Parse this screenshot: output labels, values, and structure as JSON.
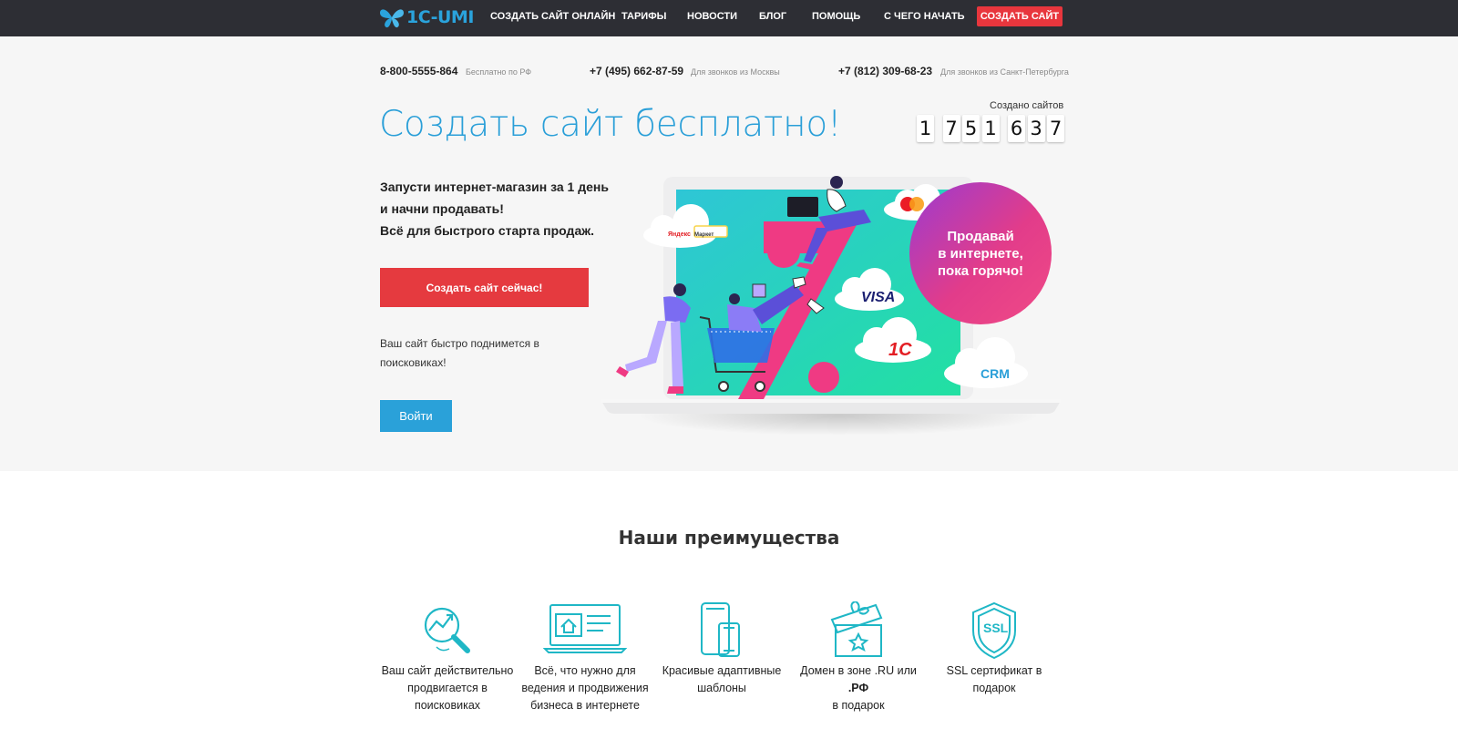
{
  "nav": {
    "logo_text": "1C-UMI",
    "items": [
      "СОЗДАТЬ САЙТ ОНЛАЙН",
      "ТАРИФЫ",
      "НОВОСТИ",
      "БЛОГ",
      "ПОМОЩЬ",
      "С ЧЕГО НАЧАТЬ"
    ],
    "cta_label": "СОЗДАТЬ САЙТ"
  },
  "phones": [
    {
      "number": "8-800-5555-864",
      "note": "Бесплатно по РФ"
    },
    {
      "number": "+7 (495) 662-87-59",
      "note": "Для звонков из Москвы"
    },
    {
      "number": "+7 (812) 309-68-23",
      "note": "Для звонков из Санкт-Петербурга"
    }
  ],
  "counter": {
    "label": "Создано сайтов",
    "digits": [
      "1",
      "7",
      "5",
      "1",
      "6",
      "3",
      "7"
    ]
  },
  "hero": {
    "title": "Создать сайт бесплатно!",
    "lead_lines": [
      "Запусти интернет-магазин за 1 день",
      "и начни продавать!",
      "Всё для быстрого старта продаж."
    ],
    "cta_label": "Создать сайт сейчас!",
    "seo_lines": [
      "Ваш сайт быстро поднимется в",
      "поисковиках!"
    ],
    "login_label": "Войти"
  },
  "illustration": {
    "promo_lines": [
      "Продавай",
      "в интернете,",
      "пока горячо!"
    ],
    "yandex_left": "Яндекс",
    "yandex_right": "Маркет",
    "visa": "VISA",
    "onec": "1С",
    "crm": "CRM"
  },
  "advantages": {
    "title": "Наши преимущества",
    "items": [
      {
        "icon": "seo-magnifier-icon",
        "lines": [
          "Ваш сайт действительно",
          "продвигается в",
          "поисковиках"
        ]
      },
      {
        "icon": "laptop-store-icon",
        "lines": [
          "Всё, что нужно для",
          "ведения и продвижения",
          "бизнеса в интернете"
        ]
      },
      {
        "icon": "responsive-devices-icon",
        "lines": [
          "Красивые адаптивные",
          "шаблоны"
        ]
      },
      {
        "icon": "gift-box-icon",
        "lines": [
          "Домен в зоне .RU или",
          ".РФ",
          "в подарок"
        ]
      },
      {
        "icon": "ssl-shield-icon",
        "lines": [
          "SSL сертификат в",
          "подарок"
        ]
      }
    ],
    "ssl_badge": "SSL"
  },
  "colors": {
    "nav_bg": "#2d2e34",
    "accent_red": "#e53a3f",
    "accent_blue": "#2aa1d9",
    "icon_teal": "#1fb7c6"
  }
}
